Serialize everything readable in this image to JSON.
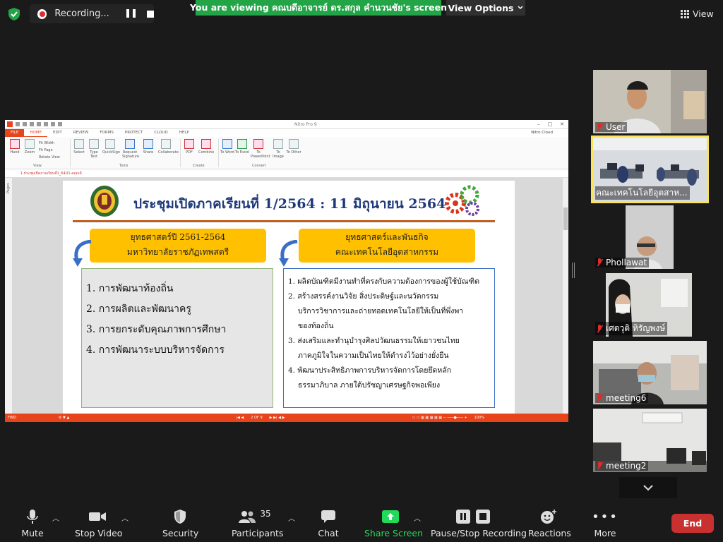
{
  "top": {
    "recording_label": "Recording...",
    "viewing_banner": "You are viewing คณบดีอาจารย์ ดร.สกุล คำนวนชัย's screen",
    "view_options": "View Options",
    "view_label": "View"
  },
  "app": {
    "title": "Nitro Pro 9",
    "cloud": "Nitro Cloud",
    "tabs": [
      "FILE",
      "HOME",
      "EDIT",
      "REVIEW",
      "FORMS",
      "PROTECT",
      "CLOUD",
      "HELP"
    ],
    "active_tab": "HOME",
    "ribbon": {
      "view_group": "View",
      "tools_group": "Tools",
      "create_group": "Create",
      "convert_group": "Convert",
      "hand": "Hand",
      "zoom": "Zoom",
      "fit_width": "Fit Width",
      "fit_page": "Fit Page",
      "rotate_view": "Rotate View",
      "select": "Select",
      "type_text": "Type Text",
      "quicksign": "QuickSign",
      "request_signature": "Request Signature",
      "share": "Share",
      "collaborate": "Collaborate",
      "pdf": "PDF",
      "combine": "Combine",
      "to_word": "To Word",
      "to_excel": "To Excel",
      "to_powerpoint": "To PowerPoint",
      "to_image": "To Image",
      "to_other": "To Other"
    },
    "doc_tab": "1.ประชุมเปิดภาคเรียนที่1_64U1-คณบดี",
    "pages_label": "Pages",
    "status": {
      "find": "FIND",
      "page": "2 OF 9",
      "zoom": "100%"
    }
  },
  "slide": {
    "title": "ประชุมเปิดภาคเรียนที่ 1/2564 : 11 มิถุนายน 2564",
    "left_head": [
      "ยุทธศาสตร์ปี 2561-2564",
      "มหาวิทยาลัยราชภัฏเทพสตรี"
    ],
    "right_head": [
      "ยุทธศาสตร์และพันธกิจ",
      "คณะเทคโนโลยีอุตสาหกรรม"
    ],
    "left_items": [
      "1. การพัฒนาท้องถิ่น",
      "2. การผลิตและพัฒนาครู",
      "3. การยกระดับคุณภาพการศึกษา",
      "4. การพัฒนาระบบบริหารจัดการ"
    ],
    "right_items": [
      {
        "line1": "1. ผลิตบัณฑิตมีงานทำที่ตรงกับความต้องการของผู้ใช้บัณฑิต",
        "line2": "",
        "line3": ""
      },
      {
        "line1": "2. สร้างสรรค์งานวิจัย สิ่งประดิษฐ์และนวัตกรรม",
        "line2": "บริการวิชาการและถ่ายทอดเทคโนโลยีให้เป็นที่พึ่งพา",
        "line3": "ของท้องถิ่น"
      },
      {
        "line1": "3. ส่งเสริมและทำนุบำรุงศิลปวัฒนธรรมให้เยาวชนไทย",
        "line2": "ภาคภูมิใจในความเป็นไทยให้ดำรงไว้อย่างยั่งยืน",
        "line3": ""
      },
      {
        "line1": "4. พัฒนาประสิทธิภาพการบริหารจัดการโดยยึดหลัก",
        "line2": "ธรรมาภิบาล ภายใต้ปรัชญาเศรษฐกิจพอเพียง",
        "line3": ""
      }
    ]
  },
  "participants": [
    {
      "name": "User",
      "muted": true
    },
    {
      "name": "คณะเทคโนโลยีอุตสาห...",
      "muted": false
    },
    {
      "name": "Phollawat",
      "muted": true
    },
    {
      "name": "เศตวุติ หิรัญพงษ์",
      "muted": true
    },
    {
      "name": "meeting6",
      "muted": true
    },
    {
      "name": "meeting2",
      "muted": true
    }
  ],
  "toolbar": {
    "mute": "Mute",
    "stop_video": "Stop Video",
    "security": "Security",
    "participants": "Participants",
    "participants_count": "35",
    "chat": "Chat",
    "share_screen": "Share Screen",
    "pause_stop_recording": "Pause/Stop Recording",
    "reactions": "Reactions",
    "more": "More",
    "end": "End"
  },
  "colors": {
    "banner_green": "#23a447",
    "share_green": "#23d959",
    "end_red": "#c93131",
    "nitro_orange": "#e8441c",
    "slide_yellow": "#ffc000",
    "title_blue": "#1f3a7a"
  }
}
